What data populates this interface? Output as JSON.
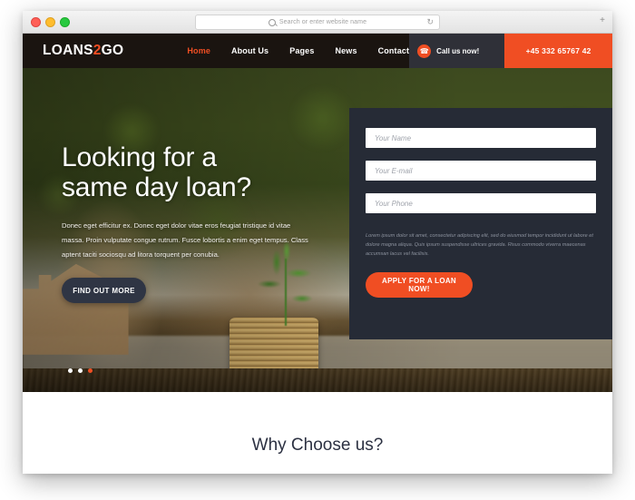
{
  "browser": {
    "url_placeholder": "Search or enter website name",
    "reload_icon": "reload-icon",
    "new_tab_icon": "plus-icon",
    "traffic_lights": [
      "close",
      "minimize",
      "maximize"
    ]
  },
  "site": {
    "logo": {
      "part1": "LOANS",
      "accent": "2",
      "part2": "GO"
    },
    "nav": [
      {
        "label": "Home",
        "active": true
      },
      {
        "label": "About Us",
        "active": false
      },
      {
        "label": "Pages",
        "active": false
      },
      {
        "label": "News",
        "active": false
      },
      {
        "label": "Contact",
        "active": false
      }
    ],
    "call": {
      "icon": "phone-icon",
      "label": "Call us now!",
      "number": "+45 332 65767 42"
    },
    "colors": {
      "accent": "#f04e23",
      "nav_bg": "#1a1410",
      "call_bg": "#2f3038",
      "panel_bg": "#262b36",
      "dark_button": "#2f3544",
      "heading": "#2c3142"
    }
  },
  "hero": {
    "title_line1": "Looking for a",
    "title_line2": "same day loan?",
    "paragraph": "Donec eget efficitur ex. Donec eget dolor vitae eros feugiat tristique id vitae massa. Proin vulputate congue rutrum. Fusce lobortis a enim eget tempus. Class aptent taciti sociosqu ad litora torquent per conubia.",
    "cta_label": "FIND OUT MORE",
    "slider_dots": [
      {
        "active": false
      },
      {
        "active": false
      },
      {
        "active": true
      }
    ]
  },
  "form": {
    "fields": [
      {
        "name": "name",
        "placeholder": "Your Name",
        "value": ""
      },
      {
        "name": "email",
        "placeholder": "Your E-mail",
        "value": ""
      },
      {
        "name": "phone",
        "placeholder": "Your Phone",
        "value": ""
      }
    ],
    "note": "Lorem ipsum dolor sit amet, consectetur adipiscing elit, sed do eiusmod tempor incididunt ut labore et dolore magna aliqua. Quis ipsum suspendisse ultrices gravida. Risus commodo viverra maecenas accumsan lacus vel facilisis.",
    "submit_label": "APPLY FOR A LOAN NOW!"
  },
  "why_section": {
    "title": "Why Choose us?"
  }
}
